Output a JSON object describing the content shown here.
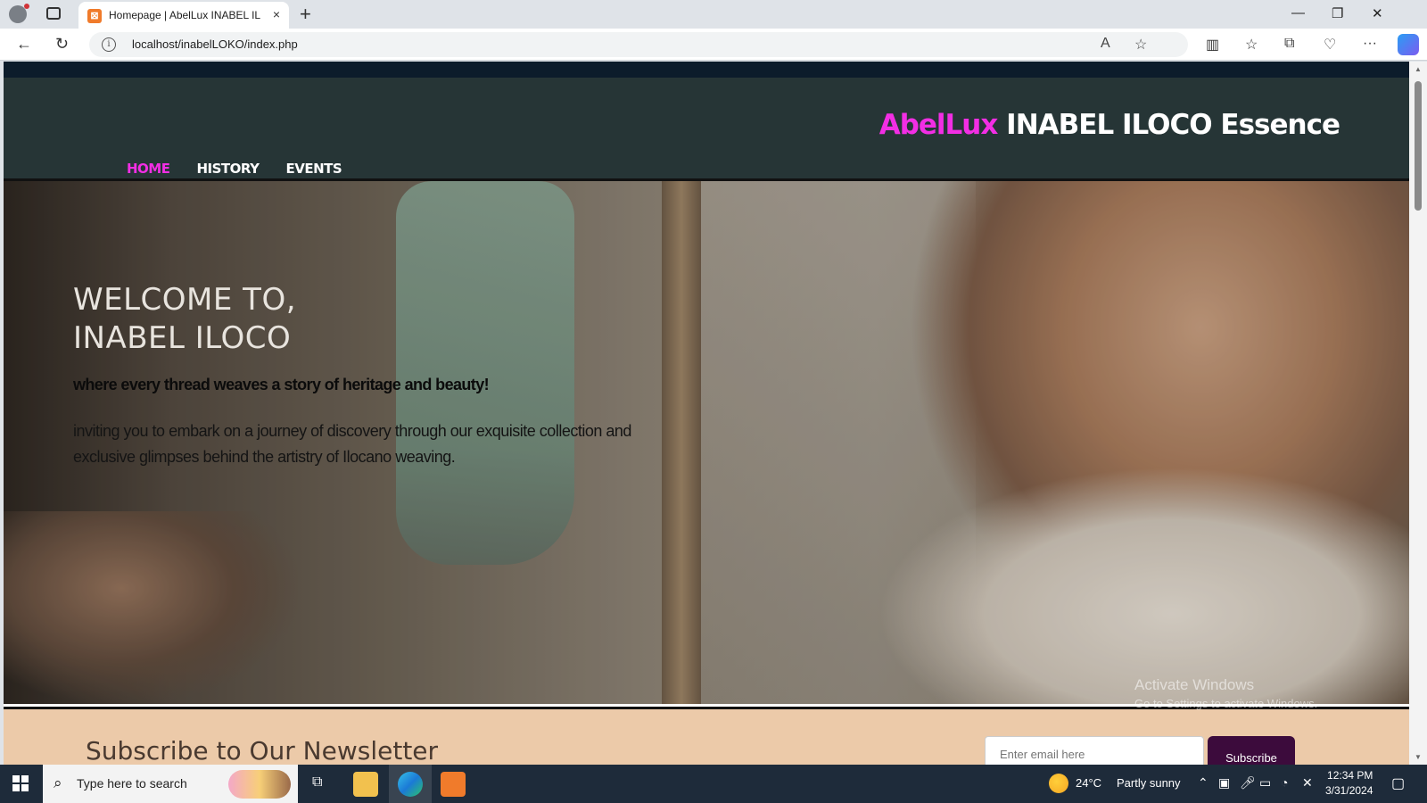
{
  "browser": {
    "tab_title": "Homepage | AbelLux INABEL ILOCO",
    "tab_close_glyph": "×",
    "new_tab_glyph": "+",
    "url": "localhost/inabelLOKO/index.php",
    "back_glyph": "←",
    "refresh_glyph": "↻",
    "info_glyph": "i"
  },
  "site": {
    "brand_accent": "AbelLux",
    "brand_rest": "INABEL ILOCO Essence",
    "nav": [
      {
        "label": "HOME",
        "active": true
      },
      {
        "label": "HISTORY",
        "active": false
      },
      {
        "label": "EVENTS",
        "active": false
      }
    ],
    "hero": {
      "heading_line1": "WELCOME TO,",
      "heading_line2": "INABEL ILOCO",
      "tagline": "where every thread weaves a story of heritage and beauty!",
      "paragraph": "inviting you to embark on a journey of discovery through our exquisite collection and exclusive glimpses behind the artistry of Ilocano weaving."
    },
    "newsletter": {
      "title": "Subscribe to Our Newsletter",
      "email_placeholder": "Enter email here",
      "subscribe_label": "Subscribe"
    }
  },
  "watermark": {
    "title": "Activate Windows",
    "subtitle": "Go to Settings to activate Windows."
  },
  "taskbar": {
    "search_placeholder": "Type here to search",
    "weather_temp": "24°C",
    "weather_desc": "Partly sunny",
    "time": "12:34 PM",
    "date": "3/31/2024"
  },
  "colors": {
    "accent_pink": "#f22ee4",
    "header_bg": "#263536",
    "newsletter_bg": "#eccaa9",
    "subscribe_bg": "#3c0b3c"
  }
}
